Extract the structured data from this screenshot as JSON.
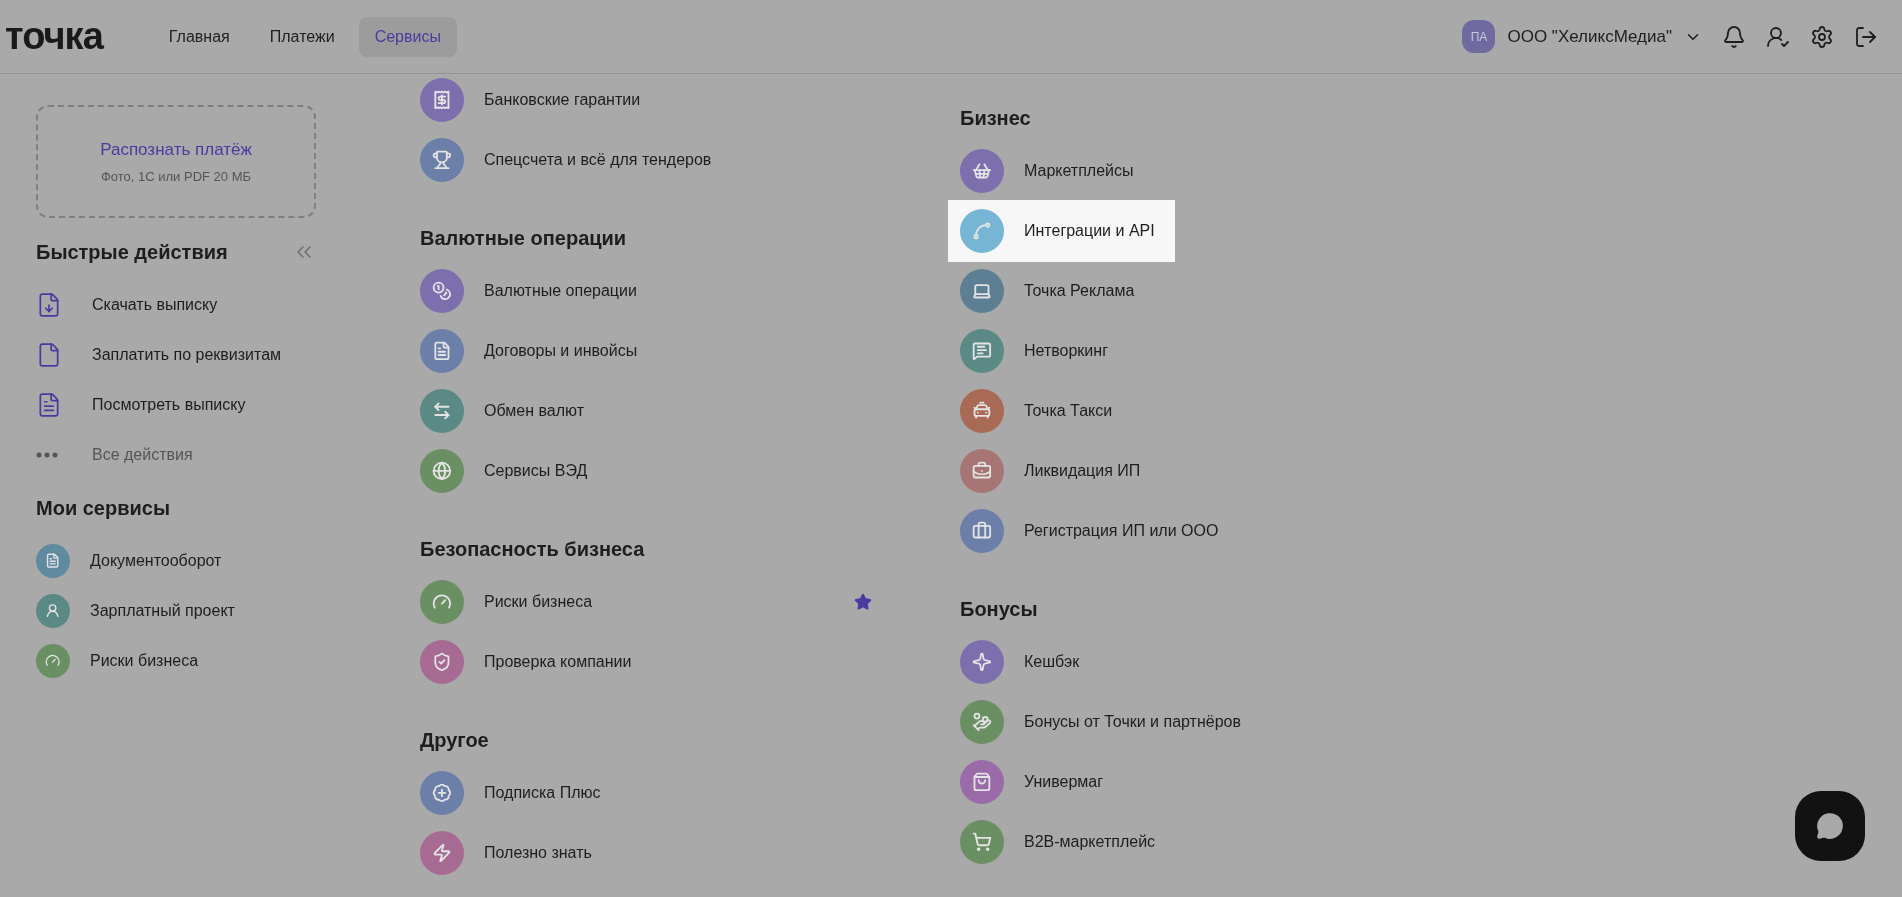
{
  "header": {
    "logo": "точка",
    "nav": [
      {
        "label": "Главная",
        "selected": false
      },
      {
        "label": "Платежи",
        "selected": false
      },
      {
        "label": "Сервисы",
        "selected": true
      }
    ],
    "account": {
      "avatar": "ПА",
      "name": "ООО \"ХеликсМедиа\""
    }
  },
  "upload_card": {
    "title": "Распознать платёж",
    "subtitle": "Фото, 1С или PDF 20 МБ"
  },
  "quick_actions": {
    "title": "Быстрые действия",
    "items": [
      {
        "label": "Скачать выписку"
      },
      {
        "label": "Заплатить по реквизитам"
      },
      {
        "label": "Посмотреть выписку"
      }
    ],
    "more": "Все действия"
  },
  "my_services": {
    "title": "Мои сервисы",
    "items": [
      {
        "label": "Документооборот",
        "color": "#5f8aa0"
      },
      {
        "label": "Зарплатный проект",
        "color": "#5b8a86"
      },
      {
        "label": "Риски бизнеса",
        "color": "#6a8f63"
      }
    ]
  },
  "columns": [
    {
      "sections": [
        {
          "items": [
            {
              "label": "Банковские гарантии",
              "color": "#7d6fae",
              "highlighted": false,
              "favorite": false
            },
            {
              "label": "Спецсчета и всё для тендеров",
              "color": "#6b7fa8",
              "highlighted": false,
              "favorite": false
            }
          ]
        },
        {
          "title": "Валютные операции",
          "items": [
            {
              "label": "Валютные операции",
              "color": "#7d6fae",
              "highlighted": false,
              "favorite": false
            },
            {
              "label": "Договоры и инвойсы",
              "color": "#6b7fa8",
              "highlighted": false,
              "favorite": false
            },
            {
              "label": "Обмен валют",
              "color": "#5b8a86",
              "highlighted": false,
              "favorite": false
            },
            {
              "label": "Сервисы ВЭД",
              "color": "#6a8f63",
              "highlighted": false,
              "favorite": false
            }
          ]
        },
        {
          "title": "Безопасность бизнеса",
          "items": [
            {
              "label": "Риски бизнеса",
              "color": "#6a8f63",
              "highlighted": false,
              "favorite": true
            },
            {
              "label": "Проверка компании",
              "color": "#a76a93",
              "highlighted": false,
              "favorite": false
            }
          ]
        },
        {
          "title": "Другое",
          "items": [
            {
              "label": "Подписка Плюс",
              "color": "#6b7fa8",
              "highlighted": false,
              "favorite": false
            },
            {
              "label": "Полезно знать",
              "color": "#a76a93",
              "highlighted": false,
              "favorite": false
            }
          ]
        }
      ]
    },
    {
      "sections": [
        {
          "title": "Бизнес",
          "items": [
            {
              "label": "Маркетплейсы",
              "color": "#7d6fae",
              "highlighted": false,
              "favorite": false
            },
            {
              "label": "Интеграции и API",
              "color": "#76b6d4",
              "highlighted": true,
              "favorite": false
            },
            {
              "label": "Точка Реклама",
              "color": "#5c7f93",
              "highlighted": false,
              "favorite": false
            },
            {
              "label": "Нетворкинг",
              "color": "#5b8a86",
              "highlighted": false,
              "favorite": false
            },
            {
              "label": "Точка Такси",
              "color": "#a86a55",
              "highlighted": false,
              "favorite": false
            },
            {
              "label": "Ликвидация ИП",
              "color": "#a87575",
              "highlighted": false,
              "favorite": false
            },
            {
              "label": "Регистрация ИП или ООО",
              "color": "#6b7fa8",
              "highlighted": false,
              "favorite": false
            }
          ]
        },
        {
          "title": "Бонусы",
          "items": [
            {
              "label": "Кешбэк",
              "color": "#7d6fae",
              "highlighted": false,
              "favorite": false
            },
            {
              "label": "Бонусы от Точки и партнёров",
              "color": "#6a8f63",
              "highlighted": false,
              "favorite": false
            },
            {
              "label": "Универмаг",
              "color": "#9b6aa8",
              "highlighted": false,
              "favorite": false
            },
            {
              "label": "B2B-маркетплейс",
              "color": "#6a8f63",
              "highlighted": false,
              "favorite": false
            }
          ]
        }
      ]
    }
  ]
}
